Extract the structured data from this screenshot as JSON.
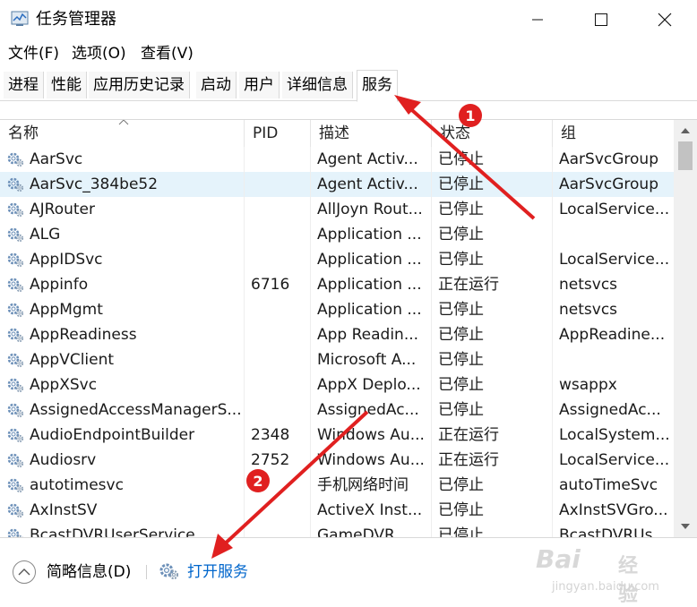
{
  "window": {
    "title": "任务管理器",
    "controls": {
      "minimize": "minimize-icon",
      "maximize": "maximize-icon",
      "close": "close-icon"
    }
  },
  "menu": [
    "文件(F)",
    "选项(O)",
    "查看(V)"
  ],
  "tabs": [
    {
      "label": "进程",
      "active": false
    },
    {
      "label": "性能",
      "active": false
    },
    {
      "label": "应用历史记录",
      "active": false
    },
    {
      "label": "启动",
      "active": false
    },
    {
      "label": "用户",
      "active": false
    },
    {
      "label": "详细信息",
      "active": false
    },
    {
      "label": "服务",
      "active": true
    }
  ],
  "columns": [
    "名称",
    "PID",
    "描述",
    "状态",
    "组"
  ],
  "services": [
    {
      "name": "AarSvc",
      "pid": "",
      "desc": "Agent Activ...",
      "status": "已停止",
      "group": "AarSvcGroup",
      "selected": false
    },
    {
      "name": "AarSvc_384be52",
      "pid": "",
      "desc": "Agent Activ...",
      "status": "已停止",
      "group": "AarSvcGroup",
      "selected": true
    },
    {
      "name": "AJRouter",
      "pid": "",
      "desc": "AllJoyn Rout...",
      "status": "已停止",
      "group": "LocalService...",
      "selected": false
    },
    {
      "name": "ALG",
      "pid": "",
      "desc": "Application ...",
      "status": "已停止",
      "group": "",
      "selected": false
    },
    {
      "name": "AppIDSvc",
      "pid": "",
      "desc": "Application ...",
      "status": "已停止",
      "group": "LocalService...",
      "selected": false
    },
    {
      "name": "Appinfo",
      "pid": "6716",
      "desc": "Application ...",
      "status": "正在运行",
      "group": "netsvcs",
      "selected": false
    },
    {
      "name": "AppMgmt",
      "pid": "",
      "desc": "Application ...",
      "status": "已停止",
      "group": "netsvcs",
      "selected": false
    },
    {
      "name": "AppReadiness",
      "pid": "",
      "desc": "App Readin...",
      "status": "已停止",
      "group": "AppReadine...",
      "selected": false
    },
    {
      "name": "AppVClient",
      "pid": "",
      "desc": "Microsoft A...",
      "status": "已停止",
      "group": "",
      "selected": false
    },
    {
      "name": "AppXSvc",
      "pid": "",
      "desc": "AppX Deplo...",
      "status": "已停止",
      "group": "wsappx",
      "selected": false
    },
    {
      "name": "AssignedAccessManagerS...",
      "pid": "",
      "desc": "AssignedAc...",
      "status": "已停止",
      "group": "AssignedAc...",
      "selected": false
    },
    {
      "name": "AudioEndpointBuilder",
      "pid": "2348",
      "desc": "Windows Au...",
      "status": "正在运行",
      "group": "LocalSystem...",
      "selected": false
    },
    {
      "name": "Audiosrv",
      "pid": "2752",
      "desc": "Windows Au...",
      "status": "正在运行",
      "group": "LocalService...",
      "selected": false
    },
    {
      "name": "autotimesvc",
      "pid": "",
      "desc": "手机网络时间",
      "status": "已停止",
      "group": "autoTimeSvc",
      "selected": false
    },
    {
      "name": "AxInstSV",
      "pid": "",
      "desc": "ActiveX Inst...",
      "status": "已停止",
      "group": "AxInstSVGro...",
      "selected": false
    },
    {
      "name": "BcastDVRUserService",
      "pid": "",
      "desc": "GameDVR ...",
      "status": "已停止",
      "group": "BcastDVRUs...",
      "selected": false
    }
  ],
  "footer": {
    "fewer_details": "简略信息(D)",
    "open_services": "打开服务"
  },
  "annotations": [
    "1",
    "2"
  ],
  "watermark": {
    "brand": "Bai",
    "brand2": "经验",
    "url": "jingyan.baidu.com"
  },
  "colors": {
    "selected_row": "#e5f3fb",
    "link": "#0066cc",
    "annotation": "#e02020"
  }
}
